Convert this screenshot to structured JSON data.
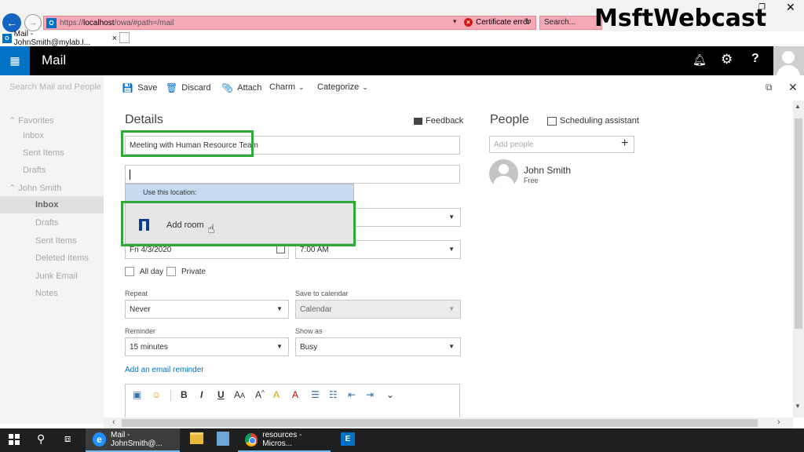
{
  "browser": {
    "url_prefix": "https://",
    "url_host": "localhost",
    "url_path": "/owa/#path=/mail",
    "cert_error": "Certificate error",
    "search_placeholder": "Search...",
    "tab_title": "Mail - JohnSmith@mylab.l...",
    "favicon": "O",
    "watermark": "MsftWebcast"
  },
  "header": {
    "app_title": "Mail",
    "waffle_glyph": "⋮⋮⋮",
    "help_glyph": "?"
  },
  "sidebar": {
    "search_placeholder": "Search Mail and People",
    "favorites_label": "Favorites",
    "favorites": [
      "Inbox",
      "Sent Items",
      "Drafts"
    ],
    "account_label": "John Smith",
    "folders": [
      "Inbox",
      "Drafts",
      "Sent Items",
      "Deleted Items",
      "Junk Email",
      "Notes"
    ]
  },
  "toolbar": {
    "save": "Save",
    "discard": "Discard",
    "attach": "Attach",
    "charm": "Charm",
    "categorize": "Categorize"
  },
  "details": {
    "title": "Details",
    "feedback": "Feedback",
    "subject_value": "Meeting with Human Resource Team",
    "location_value": "",
    "dropdown_header": "Use this location:",
    "dropdown_item": "Add room",
    "start_date": "Fri 4/3/2020",
    "start_time": "7:00 AM",
    "all_day": "All day",
    "private": "Private",
    "repeat_label": "Repeat",
    "repeat_value": "Never",
    "save_to_calendar_label": "Save to calendar",
    "save_to_calendar_value": "Calendar",
    "reminder_label": "Reminder",
    "reminder_value": "15 minutes",
    "show_as_label": "Show as",
    "show_as_value": "Busy",
    "add_email_reminder": "Add an email reminder"
  },
  "people": {
    "title": "People",
    "scheduling": "Scheduling assistant",
    "add_people_placeholder": "Add people",
    "person_name": "John Smith",
    "person_status": "Free"
  },
  "taskbar": {
    "ie_title": "Mail - JohnSmith@...",
    "chrome_title": "resources - Micros..."
  },
  "colors": {
    "accent": "#0072c6",
    "highlight_green": "#2eaa3a",
    "cert_error_bg": "#f6a9b5"
  }
}
